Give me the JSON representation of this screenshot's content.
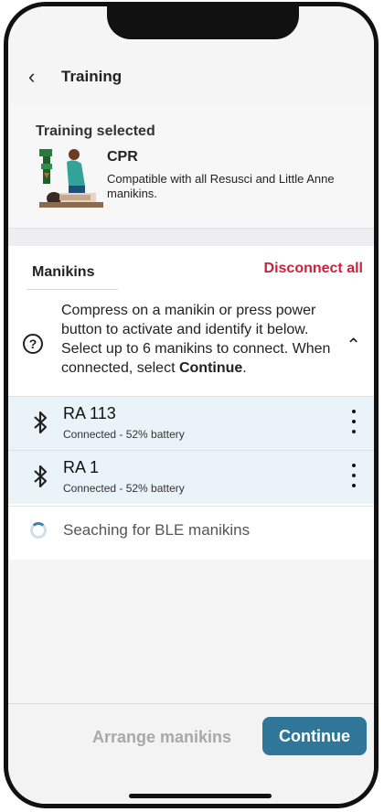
{
  "header": {
    "back_icon": "chevron-left-icon",
    "title": "Training"
  },
  "training": {
    "selected_label": "Training selected",
    "name": "CPR",
    "description": "Compatible with all Resusci and Little Anne manikins."
  },
  "manikins": {
    "title": "Manikins",
    "disconnect_label": "Disconnect all",
    "info_text": "Compress on a manikin or press power button to activate and identify it below. Select up to 6 manikins to connect. When connected, select ",
    "info_bold": "Continue",
    "info_end": ".",
    "help_glyph": "?",
    "collapse_icon": "chevron-up-icon",
    "devices": [
      {
        "name": "RA 113",
        "status": "Connected - 52% battery"
      },
      {
        "name": "RA 1",
        "status": "Connected - 52% battery"
      }
    ],
    "searching_text": "Seaching for BLE manikins"
  },
  "footer": {
    "arrange_label": "Arrange manikins",
    "continue_label": "Continue"
  },
  "colors": {
    "accent": "#2f7698",
    "danger": "#d0203c",
    "row_bg": "#eaf3f8"
  }
}
